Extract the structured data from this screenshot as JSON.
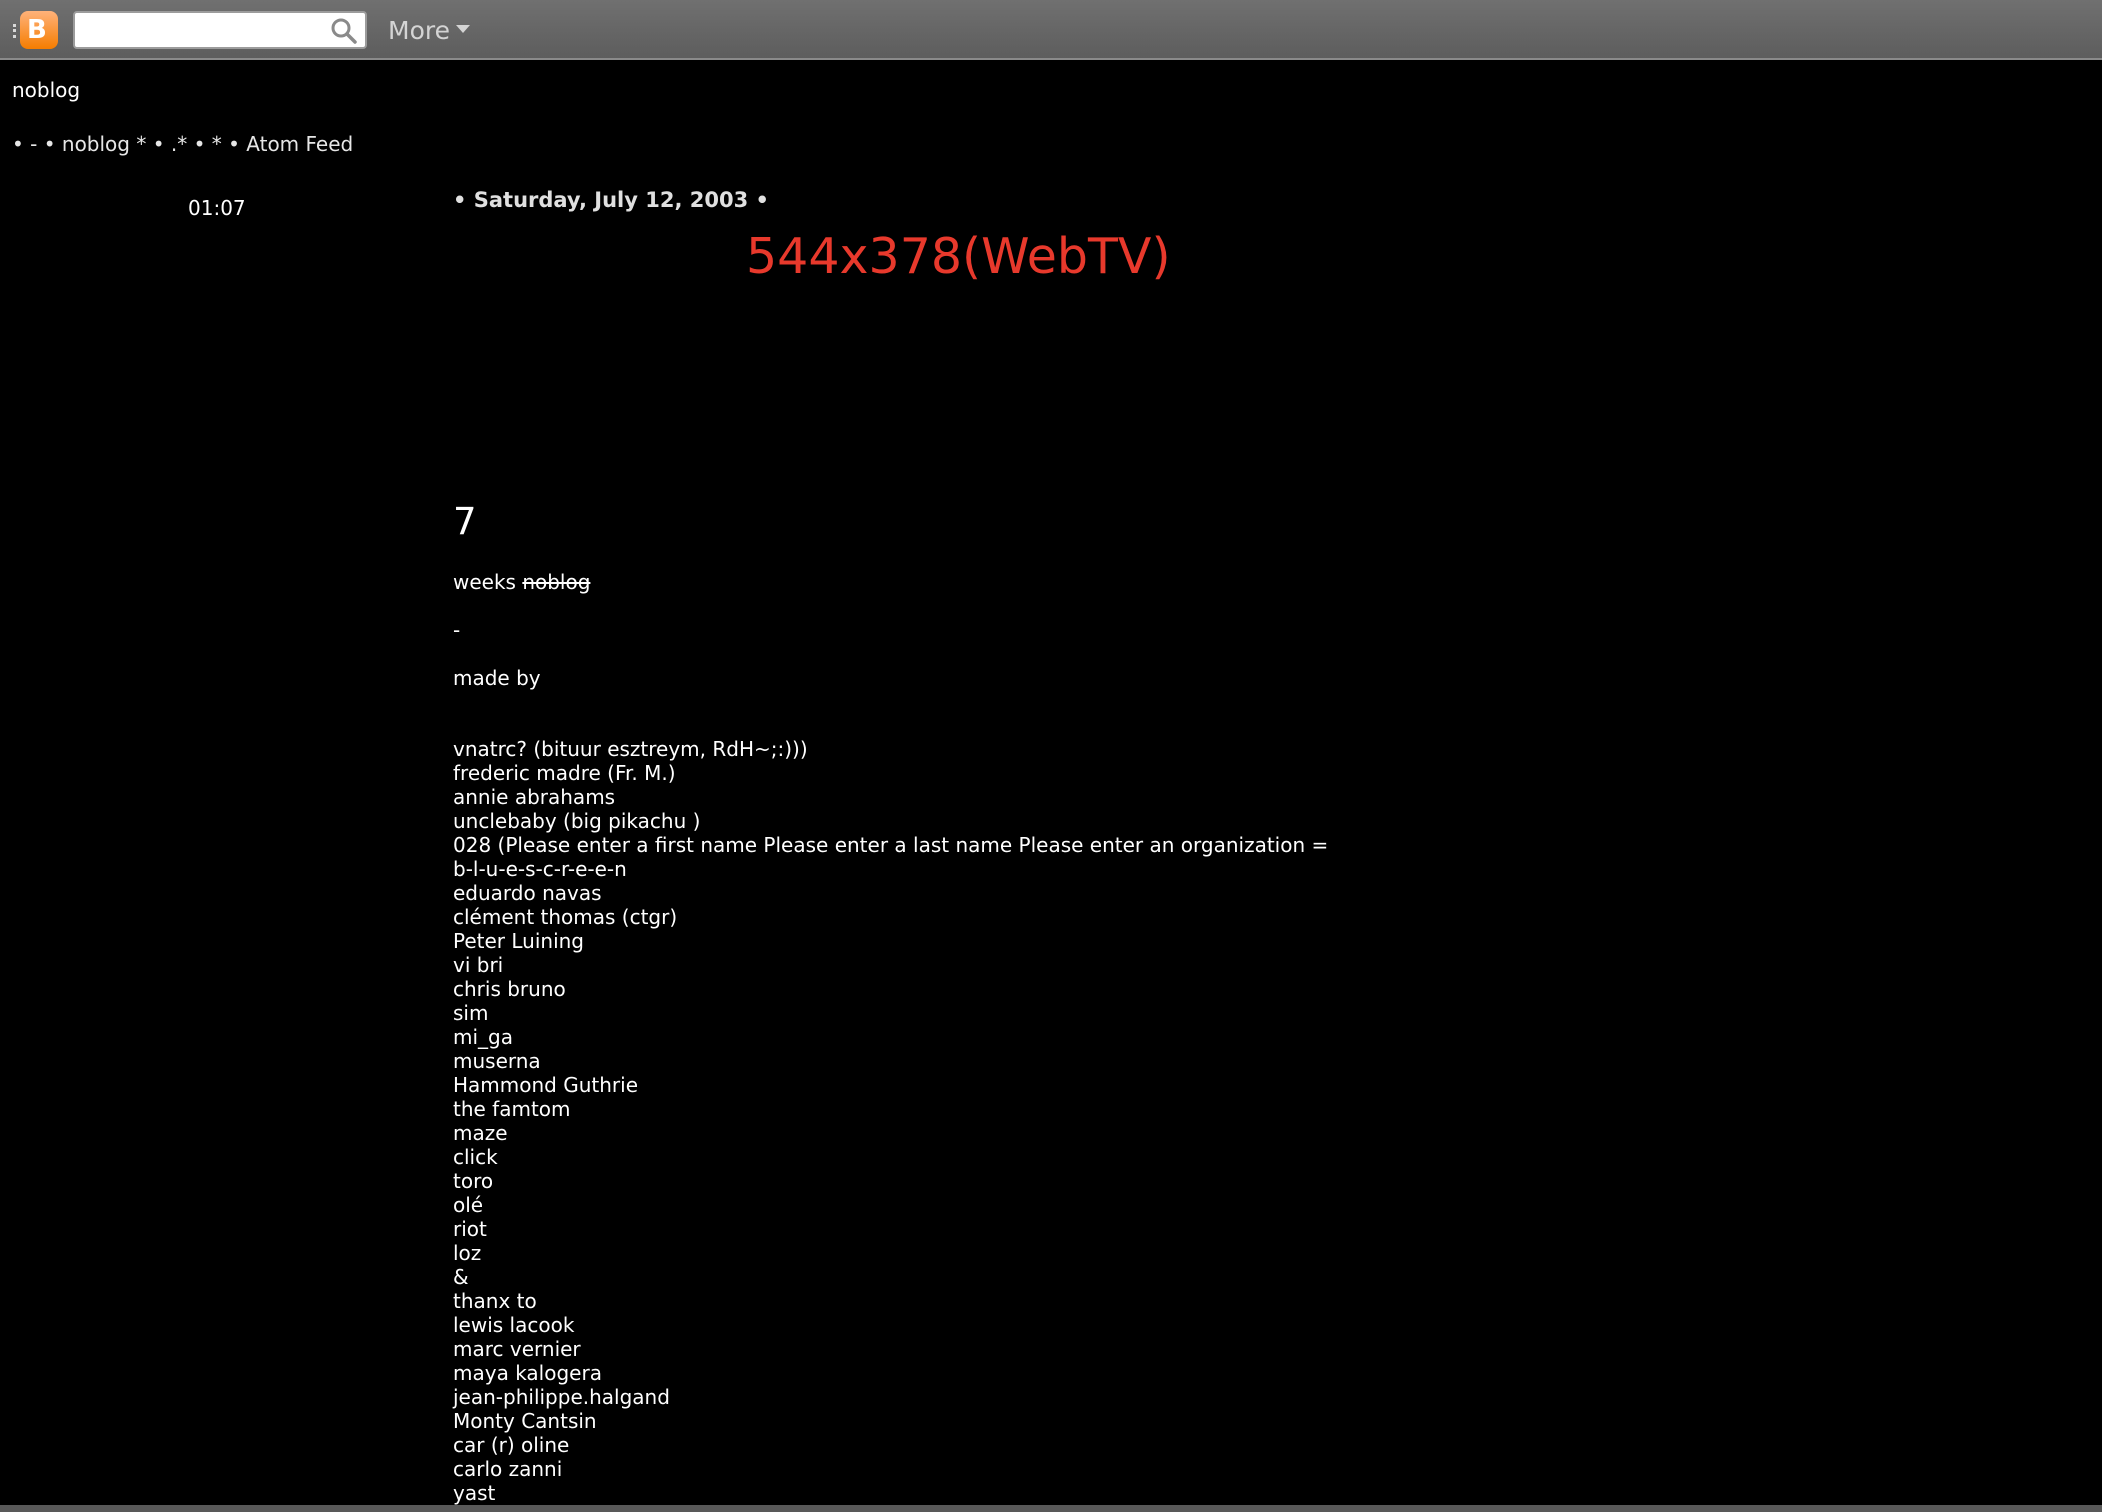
{
  "navbar": {
    "logo_glyph": "B",
    "search_placeholder": "",
    "more_label": "More"
  },
  "blog": {
    "title": "noblog",
    "header_links": {
      "prefix": "• - •",
      "noblog_link": "noblog",
      "middle": "* • .* • * •",
      "atom_link": "Atom Feed"
    }
  },
  "post": {
    "time": "01:07",
    "date": "• Saturday, July 12, 2003 •",
    "resolution_text": "544x378(WebTV)",
    "big_number": "7",
    "weeks_word": "weeks",
    "weeks_struck": "noblog",
    "dash": "-",
    "made_by": "made by",
    "credits": [
      "vnatrc? (bituur esztreym, RdH~;:)))",
      "frederic madre (Fr. M.)",
      "annie abrahams",
      "unclebaby (big pikachu )",
      "028 (Please enter a first name Please enter a last name Please enter an organization =",
      "b-l-u-e-s-c-r-e-e-n",
      "eduardo navas",
      "clément thomas (ctgr)",
      "Peter Luining",
      "vi bri",
      "chris bruno",
      "sim",
      "mi_ga",
      "muserna",
      "Hammond Guthrie",
      "the famtom",
      "maze",
      "click",
      "toro",
      "olé",
      "riot",
      "loz",
      "&",
      "thanx to",
      "lewis lacook",
      "marc vernier",
      "maya kalogera",
      "jean-philippe.halgand",
      "Monty Cantsin",
      "car (r) oline",
      "carlo zanni",
      "yast"
    ]
  },
  "colors": {
    "background": "#000000",
    "navbar": "#666666",
    "resolution_text": "#e8392c",
    "logo": "#f57d00"
  }
}
